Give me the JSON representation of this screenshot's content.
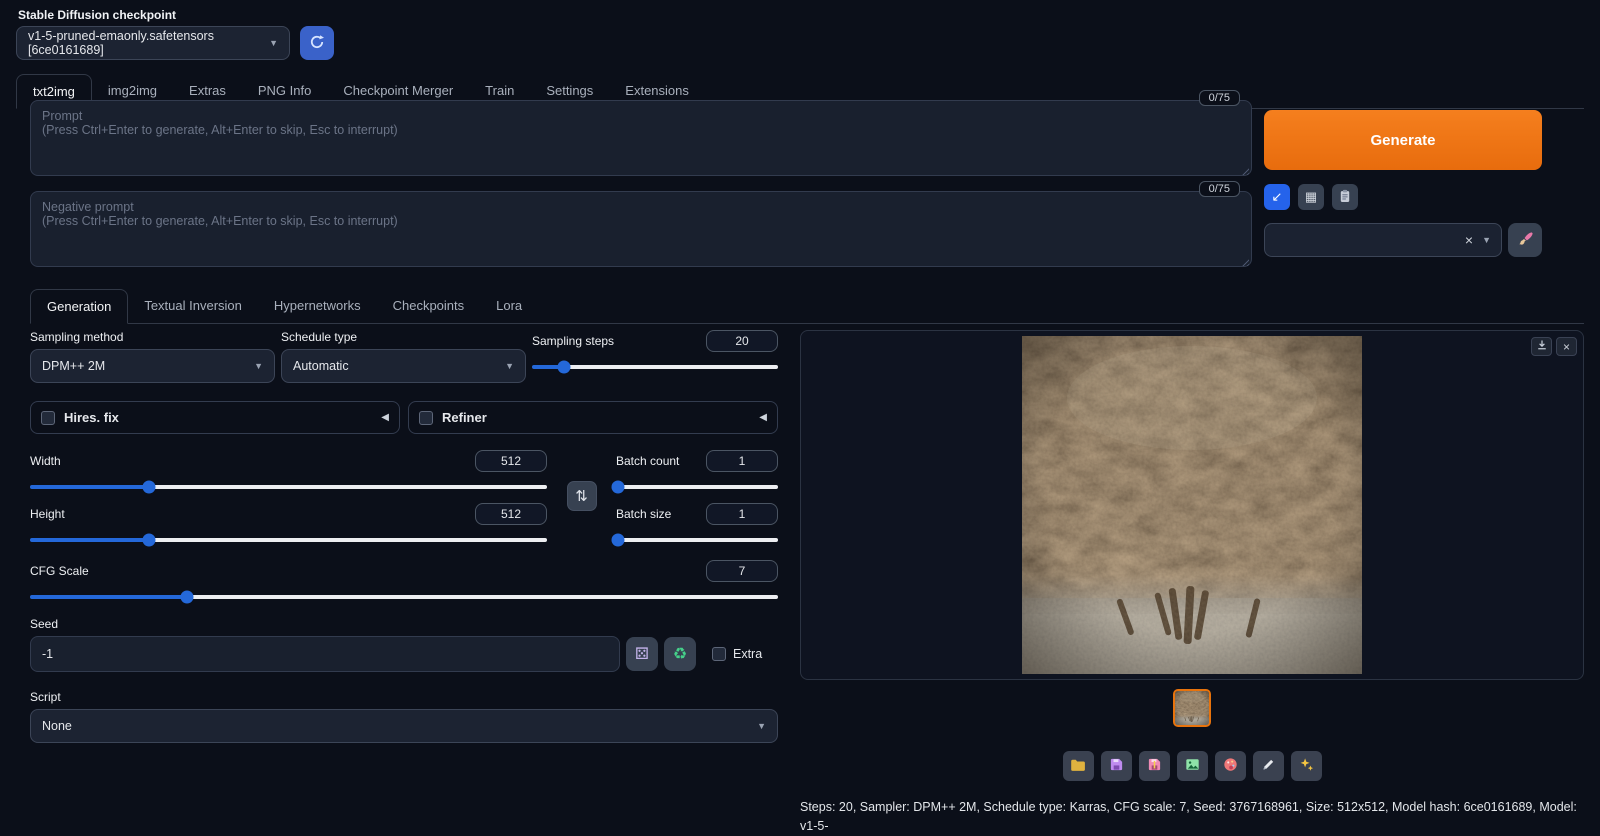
{
  "header": {
    "checkpoint_label": "Stable Diffusion checkpoint",
    "checkpoint_value": "v1-5-pruned-emaonly.safetensors [6ce0161689]"
  },
  "tabs": {
    "main": [
      "txt2img",
      "img2img",
      "Extras",
      "PNG Info",
      "Checkpoint Merger",
      "Train",
      "Settings",
      "Extensions"
    ],
    "sub": [
      "Generation",
      "Textual Inversion",
      "Hypernetworks",
      "Checkpoints",
      "Lora"
    ]
  },
  "prompt": {
    "counter": "0/75",
    "value": "",
    "placeholder": "Prompt\n(Press Ctrl+Enter to generate, Alt+Enter to skip, Esc to interrupt)"
  },
  "negative_prompt": {
    "counter": "0/75",
    "value": "",
    "placeholder": "Negative prompt\n(Press Ctrl+Enter to generate, Alt+Enter to skip, Esc to interrupt)"
  },
  "actions": {
    "generate_label": "Generate",
    "styles_value": ""
  },
  "icons": {
    "caret_down": "▼",
    "collapse_left": "◀",
    "swap": "⇅",
    "dice": "⚄",
    "recycle": "♻",
    "clear": "×",
    "close": "×",
    "paste": "↙",
    "extra_networks": "▦"
  },
  "generation": {
    "sampling_method": {
      "label": "Sampling method",
      "value": "DPM++ 2M"
    },
    "schedule_type": {
      "label": "Schedule type",
      "value": "Automatic"
    },
    "sampling_steps": {
      "label": "Sampling steps",
      "value": "20",
      "fill": 13
    },
    "hires_fix": {
      "label": "Hires. fix"
    },
    "refiner": {
      "label": "Refiner"
    },
    "width": {
      "label": "Width",
      "value": "512",
      "fill": 23
    },
    "height": {
      "label": "Height",
      "value": "512",
      "fill": 23
    },
    "batch_count": {
      "label": "Batch count",
      "value": "1",
      "fill": 1
    },
    "batch_size": {
      "label": "Batch size",
      "value": "1",
      "fill": 1
    },
    "cfg_scale": {
      "label": "CFG Scale",
      "value": "7",
      "fill": 21
    },
    "seed": {
      "label": "Seed",
      "value": "-1",
      "extra_label": "Extra"
    },
    "script": {
      "label": "Script",
      "value": "None"
    }
  },
  "output": {
    "info": "Steps: 20, Sampler: DPM++ 2M, Schedule type: Karras, CFG scale: 7, Seed: 3767168961, Size: 512x512, Model hash: 6ce0161689, Model: v1-5-"
  },
  "colors": {
    "accent_orange": "#ee7216",
    "accent_blue": "#2563eb",
    "slider_blue": "#2468d9",
    "background": "#0b0f19"
  }
}
